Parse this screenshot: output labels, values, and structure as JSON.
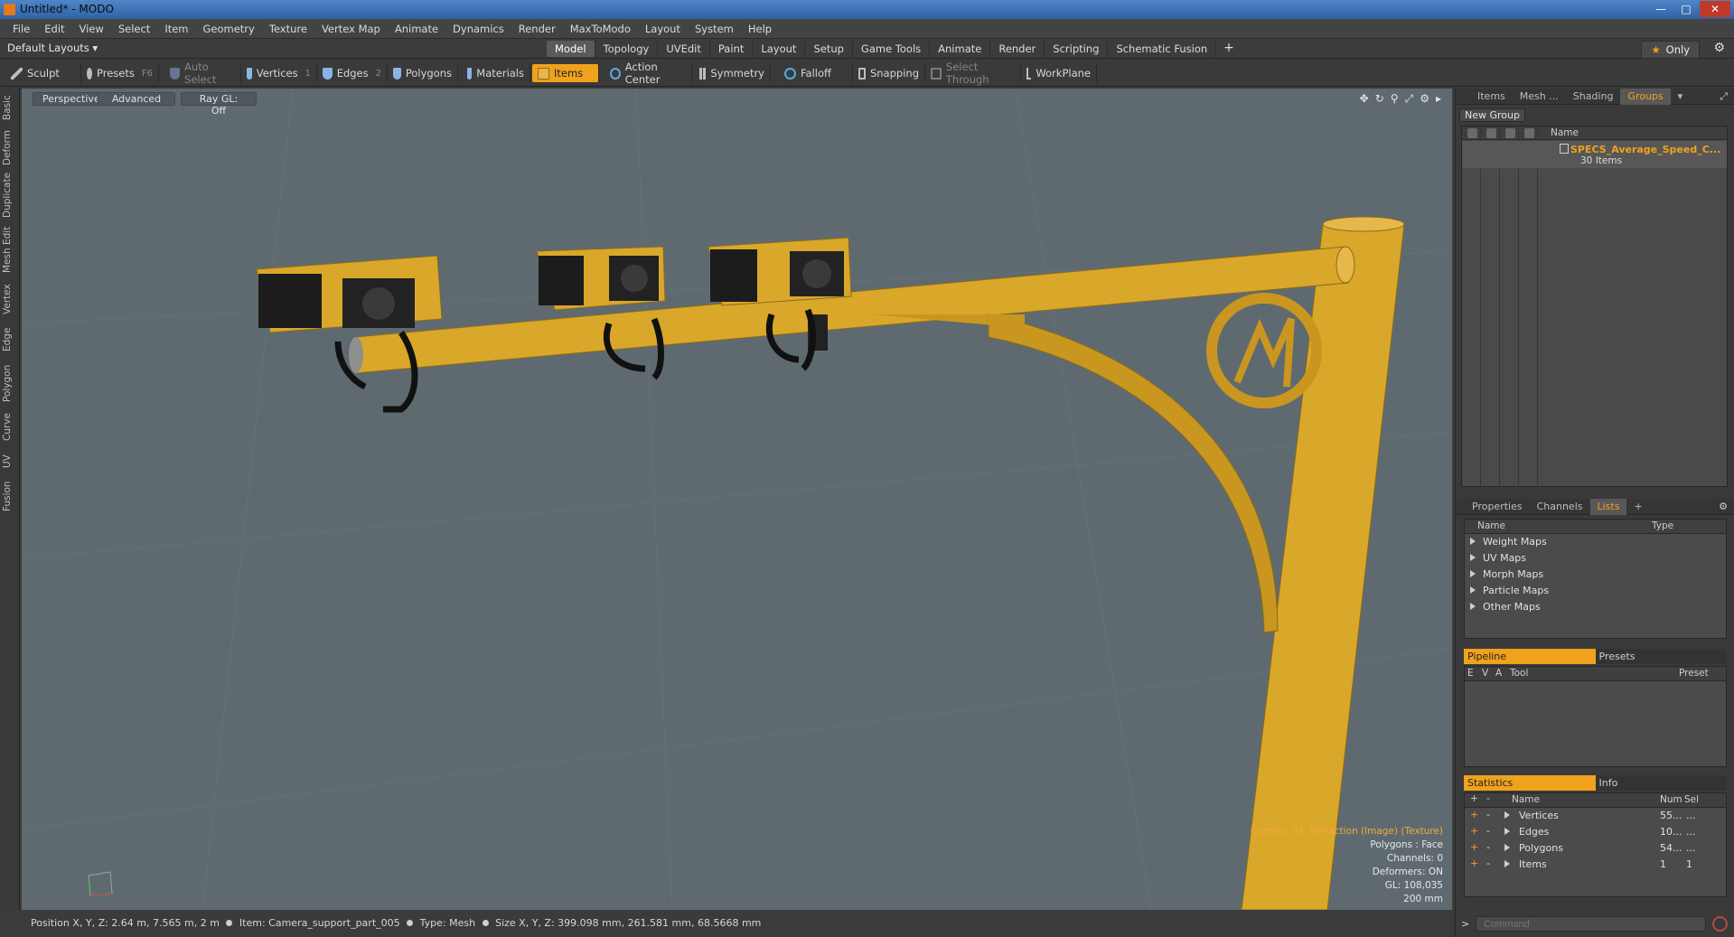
{
  "window": {
    "title": "Untitled* - MODO"
  },
  "menu": [
    "File",
    "Edit",
    "View",
    "Select",
    "Item",
    "Geometry",
    "Texture",
    "Vertex Map",
    "Animate",
    "Dynamics",
    "Render",
    "MaxToModo",
    "Layout",
    "System",
    "Help"
  ],
  "layout": {
    "selector": "Default Layouts",
    "tabs": [
      "Model",
      "Topology",
      "UVEdit",
      "Paint",
      "Layout",
      "Setup",
      "Game Tools",
      "Animate",
      "Render",
      "Scripting",
      "Schematic Fusion"
    ],
    "active_tab": "Model",
    "only_label": "Only"
  },
  "toolbar": {
    "sculpt": "Sculpt",
    "presets": "Presets",
    "presets_key": "F6",
    "auto_select": "Auto Select",
    "vertices": "Vertices",
    "vertices_key": "1",
    "edges": "Edges",
    "edges_key": "2",
    "polygons": "Polygons",
    "materials": "Materials",
    "items": "Items",
    "action_center": "Action Center",
    "symmetry": "Symmetry",
    "falloff": "Falloff",
    "snapping": "Snapping",
    "select_through": "Select Through",
    "workplane": "WorkPlane"
  },
  "left_tabs": [
    "Basic",
    "Deform",
    "Duplicate",
    "Mesh Edit",
    "Vertex",
    "Edge",
    "Polygon",
    "Curve",
    "UV",
    "Fusion"
  ],
  "viewport": {
    "view_mode": "Perspective",
    "shading": "Advanced",
    "raygl": "Ray GL: Off",
    "info": {
      "texture": "Camera_01_Refraction (Image) (Texture)",
      "polygons": "Polygons : Face",
      "channels": "Channels: 0",
      "deformers": "Deformers: ON",
      "gl": "GL: 108,035",
      "scale": "200 mm"
    },
    "colors": {
      "background": "#5f6a70",
      "object": "#d9a72a",
      "object_dark": "#a77f1e"
    }
  },
  "status": {
    "position_label": "Position X, Y, Z:",
    "position_value": "2.64 m, 7.565 m, 2 m",
    "item_label": "Item:",
    "item_value": "Camera_support_part_005",
    "type_label": "Type:",
    "type_value": "Mesh",
    "size_label": "Size X, Y, Z:",
    "size_value": "399.098 mm, 261.581 mm, 68.5668 mm"
  },
  "groups_panel": {
    "tabs": [
      "Items",
      "Mesh ...",
      "Shading",
      "Groups"
    ],
    "active_tab": "Groups",
    "new_group": "New Group",
    "col_name": "Name",
    "row_name": "SPECS_Average_Speed_C...",
    "row_sub": "30 Items"
  },
  "lists_panel": {
    "tabs": [
      "Properties",
      "Channels",
      "Lists"
    ],
    "active_tab": "Lists",
    "col_name": "Name",
    "col_type": "Type",
    "items": [
      "Weight Maps",
      "UV Maps",
      "Morph Maps",
      "Particle Maps",
      "Other Maps"
    ]
  },
  "pipeline_panel": {
    "tabs": [
      "Pipeline",
      "Presets"
    ],
    "cols": [
      "E",
      "V",
      "A",
      "Tool",
      "Preset"
    ]
  },
  "stats_panel": {
    "tabs": [
      "Statistics",
      "Info"
    ],
    "cols": {
      "name": "Name",
      "num": "Num",
      "sel": "Sel"
    },
    "rows": [
      {
        "name": "Vertices",
        "num": "55...",
        "sel": "..."
      },
      {
        "name": "Edges",
        "num": "10...",
        "sel": "..."
      },
      {
        "name": "Polygons",
        "num": "54...",
        "sel": "..."
      },
      {
        "name": "Items",
        "num": "1",
        "sel": "1"
      }
    ]
  },
  "command": {
    "placeholder": "Command"
  }
}
